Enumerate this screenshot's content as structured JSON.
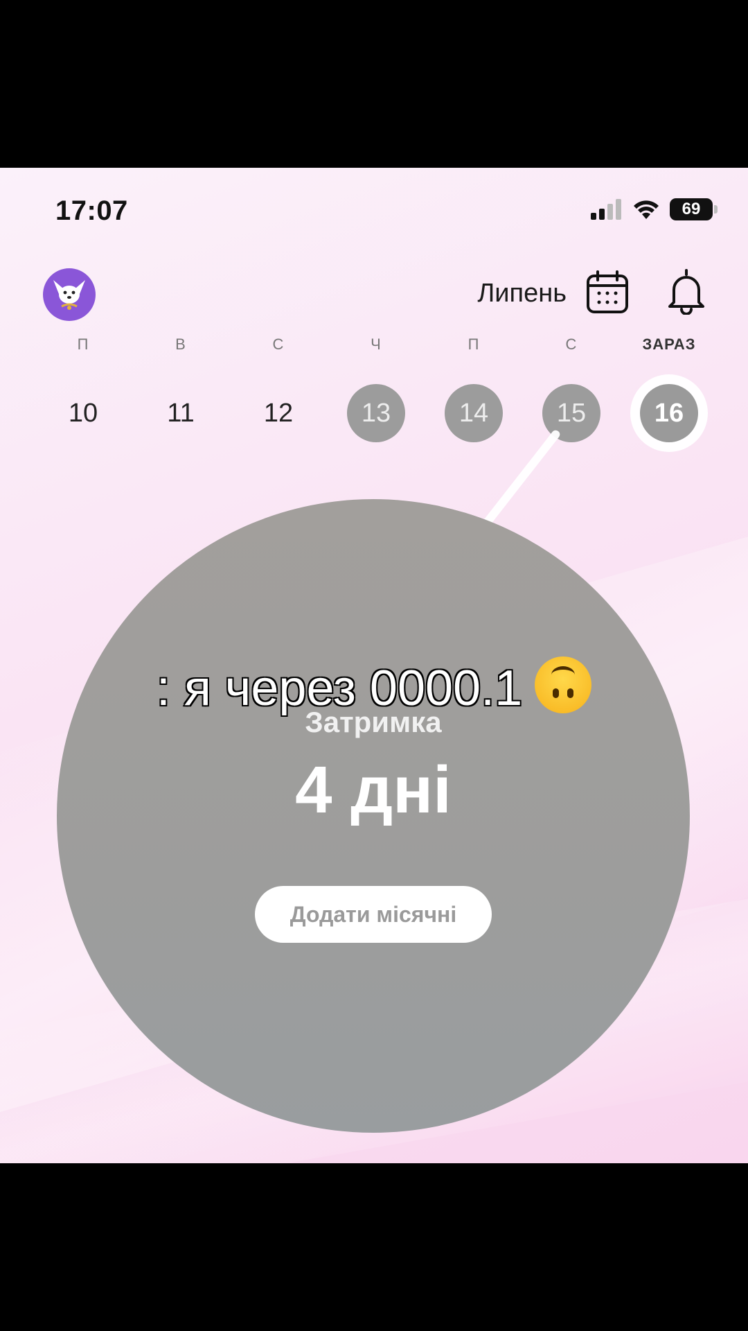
{
  "status_bar": {
    "time": "17:07",
    "battery": "69"
  },
  "header": {
    "month": "Липень",
    "icons": [
      "avatar-dog",
      "calendar-icon",
      "bell-icon"
    ]
  },
  "week": {
    "weekdays": [
      "П",
      "В",
      "С",
      "Ч",
      "П",
      "С",
      "ЗАРАЗ"
    ],
    "days": [
      "10",
      "11",
      "12",
      "13",
      "14",
      "15",
      "16"
    ],
    "future_days": [
      "13",
      "14",
      "15"
    ],
    "today": "16"
  },
  "cycle": {
    "title": "Затримка",
    "value": "4 дні",
    "button_label": "Додати місячні"
  },
  "caption": {
    "text": ": я через 0000.1",
    "emoji": "upside-down-face"
  },
  "colors": {
    "circle": "#9e9e9d",
    "future_day": "#9c9c9c",
    "avatar_bg": "#8a56d8",
    "background_pink": "#fae4f4"
  }
}
